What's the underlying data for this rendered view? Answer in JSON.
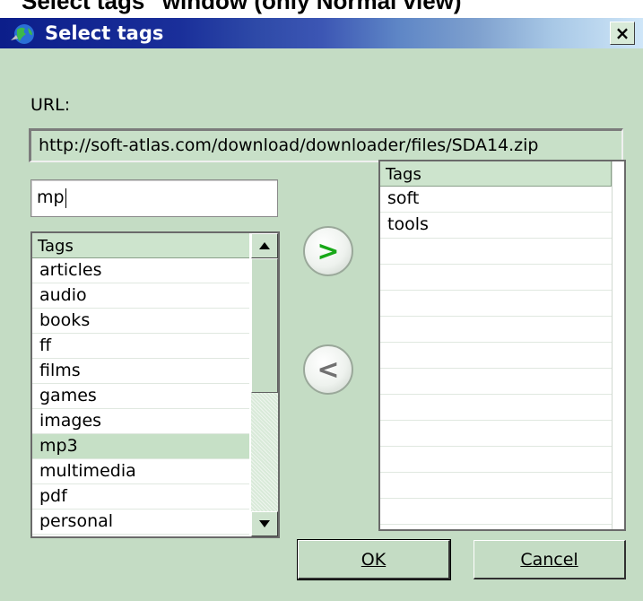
{
  "caption": "Select tags\" window (only Normal view)",
  "window": {
    "title": "Select tags",
    "close_glyph": "×"
  },
  "url": {
    "label": "URL:",
    "value": "http://soft-atlas.com/download/downloader/files/SDA14.zip"
  },
  "filter": {
    "value": "mp"
  },
  "available": {
    "header": "Tags",
    "items": [
      "articles",
      "audio",
      "books",
      "ff",
      "films",
      "games",
      "images",
      "mp3",
      "multimedia",
      "pdf",
      "personal"
    ],
    "selected": "mp3"
  },
  "chosen": {
    "header": "Tags",
    "items": [
      "soft",
      "tools"
    ]
  },
  "actions": {
    "add_glyph": ">",
    "remove_glyph": "<"
  },
  "buttons": {
    "ok": "OK",
    "cancel": "Cancel"
  },
  "icons": {
    "app": "globe-icon",
    "close": "close-icon",
    "up": "scroll-up-icon",
    "down": "scroll-down-icon"
  },
  "colors": {
    "window_bg": "#c4dcc4",
    "add_arrow": "#18a818",
    "remove_arrow": "#707070"
  }
}
